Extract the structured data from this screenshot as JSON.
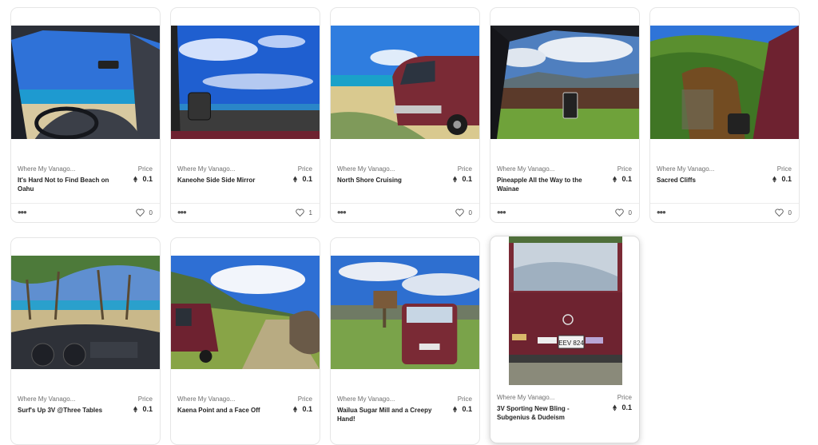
{
  "cards": [
    {
      "collection": "Where My Vanago...",
      "title": "It's Hard Not to Find Beach on Oahu",
      "price_label": "Price",
      "price": "0.1",
      "likes": "0",
      "more_icon": "more-dots-icon",
      "like_icon": "heart-icon"
    },
    {
      "collection": "Where My Vanago...",
      "title": "Kaneohe Side Side Mirror",
      "price_label": "Price",
      "price": "0.1",
      "likes": "1",
      "more_icon": "more-dots-icon",
      "like_icon": "heart-icon"
    },
    {
      "collection": "Where My Vanago...",
      "title": "North Shore Cruising",
      "price_label": "Price",
      "price": "0.1",
      "likes": "0",
      "more_icon": "more-dots-icon",
      "like_icon": "heart-icon"
    },
    {
      "collection": "Where My Vanago...",
      "title": "Pineapple All the Way to the Wainae",
      "price_label": "Price",
      "price": "0.1",
      "likes": "0",
      "more_icon": "more-dots-icon",
      "like_icon": "heart-icon"
    },
    {
      "collection": "Where My Vanago...",
      "title": "Sacred Cliffs",
      "price_label": "Price",
      "price": "0.1",
      "likes": "0",
      "more_icon": "more-dots-icon",
      "like_icon": "heart-icon"
    },
    {
      "collection": "Where My Vanago...",
      "title": "Surf's Up 3V @Three Tables",
      "price_label": "Price",
      "price": "0.1"
    },
    {
      "collection": "Where My Vanago...",
      "title": "Kaena Point and a Face Off",
      "price_label": "Price",
      "price": "0.1"
    },
    {
      "collection": "Where My Vanago...",
      "title": "Wailua Sugar Mill and a Creepy Hand!",
      "price_label": "Price",
      "price": "0.1"
    },
    {
      "collection": "Where My Vanago...",
      "title": "3V Sporting New Bling - Subgenius & Dudeism",
      "price_label": "Price",
      "price": "0.1",
      "plate": "EEV 824"
    }
  ],
  "currency_icon": "ethereum-icon",
  "colors": {
    "van": "#7a2a35",
    "sky": "#2f6fd6",
    "ocean": "#1b8fc7",
    "grass": "#5f9a34"
  }
}
